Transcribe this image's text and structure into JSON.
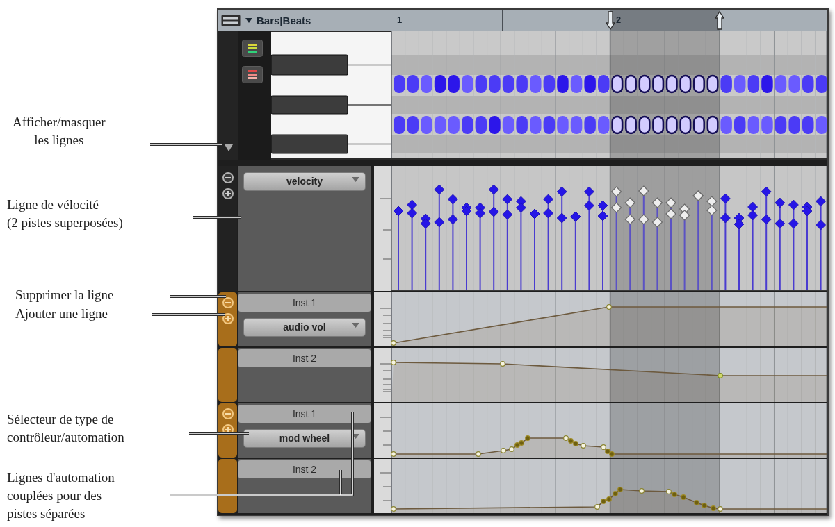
{
  "callouts": [
    "Afficher/masquer\nles lignes",
    "Ligne de vélocité\n(2 pistes superposées)",
    "Supprimer la ligne",
    "Ajouter une ligne",
    "Sélecteur de type de\ncontrôleur/automation",
    "Lignes d'automation\ncouplées pour des\npistes séparées"
  ],
  "editor": {
    "timebase": "Bars|Beats",
    "ruler_marks": [
      "1",
      "2"
    ],
    "lanes": [
      {
        "kind": "velocity",
        "controller": "velocity"
      },
      {
        "kind": "automation",
        "track": "Inst 1",
        "controller": "audio vol"
      },
      {
        "kind": "automation",
        "track": "Inst 2"
      },
      {
        "kind": "automation",
        "track": "Inst 1",
        "controller": "mod wheel"
      },
      {
        "kind": "automation",
        "track": "Inst 2"
      }
    ]
  }
}
